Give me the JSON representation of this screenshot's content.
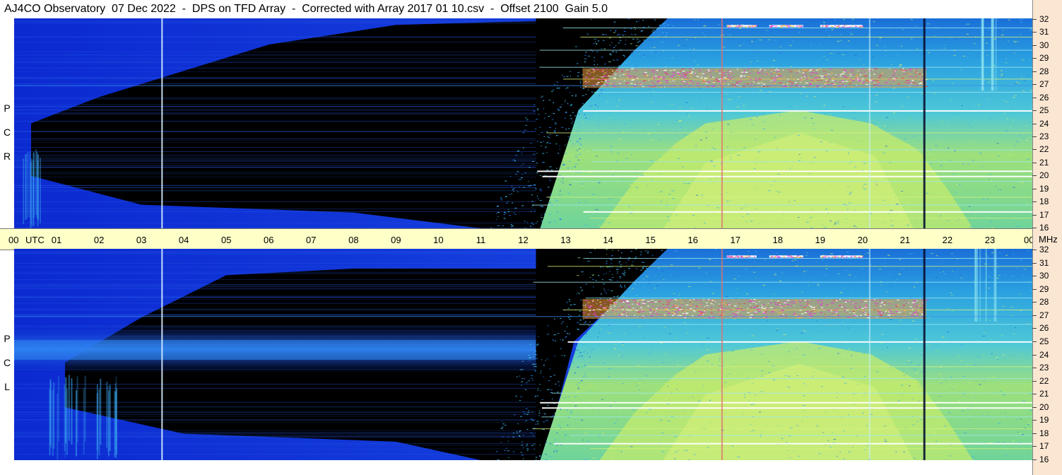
{
  "title": "AJ4CO Observatory  07 Dec 2022  -  DPS on TFD Array  -  Corrected with Array 2017 01 10.csv  -  Offset 2100  Gain 5.0",
  "chart_data": [
    {
      "type": "heatmap",
      "panel": "RCP",
      "polarization_label": [
        "R",
        "C",
        "P"
      ],
      "x_unit": "UTC",
      "y_unit": "MHz",
      "x_ticks": [
        "00",
        "01",
        "02",
        "03",
        "04",
        "05",
        "06",
        "07",
        "08",
        "09",
        "10",
        "11",
        "12",
        "13",
        "14",
        "15",
        "16",
        "17",
        "18",
        "19",
        "20",
        "21",
        "22",
        "23",
        "00"
      ],
      "y_ticks": [
        "32",
        "31",
        "30",
        "29",
        "28",
        "27",
        "26",
        "25",
        "24",
        "23",
        "22",
        "21",
        "20",
        "19",
        "18",
        "17",
        "16"
      ],
      "xlim": [
        0,
        24
      ],
      "ylim": [
        16,
        32
      ]
    },
    {
      "type": "heatmap",
      "panel": "LCP",
      "polarization_label": [
        "L",
        "C",
        "P"
      ],
      "x_unit": "UTC",
      "y_unit": "MHz",
      "x_ticks": [
        "00",
        "01",
        "02",
        "03",
        "04",
        "05",
        "06",
        "07",
        "08",
        "09",
        "10",
        "11",
        "12",
        "13",
        "14",
        "15",
        "16",
        "17",
        "18",
        "19",
        "20",
        "21",
        "22",
        "23",
        "00"
      ],
      "y_ticks": [
        "32",
        "31",
        "30",
        "29",
        "28",
        "27",
        "26",
        "25",
        "24",
        "23",
        "22",
        "21",
        "20",
        "19",
        "18",
        "17",
        "16"
      ],
      "xlim": [
        0,
        24
      ],
      "ylim": [
        16,
        32
      ]
    }
  ],
  "axis": {
    "utc_label": "UTC",
    "mhz_label": "MHz",
    "hours": [
      "00",
      "01",
      "02",
      "03",
      "04",
      "05",
      "06",
      "07",
      "08",
      "09",
      "10",
      "11",
      "12",
      "13",
      "14",
      "15",
      "16",
      "17",
      "18",
      "19",
      "20",
      "21",
      "22",
      "23",
      "00"
    ],
    "freqs": [
      "32",
      "31",
      "30",
      "29",
      "28",
      "27",
      "26",
      "25",
      "24",
      "23",
      "22",
      "21",
      "20",
      "19",
      "18",
      "17",
      "16"
    ]
  },
  "colors": {
    "axis_strip": "#ffffc8",
    "freq_strip": "#fbe6d2",
    "night": "#000000",
    "dark_blue": "#0a1fa0",
    "blue": "#1f55e6",
    "cyan": "#3bc0e8",
    "yellow_green": "#c6ec6c",
    "magenta": "#e63cd6"
  }
}
